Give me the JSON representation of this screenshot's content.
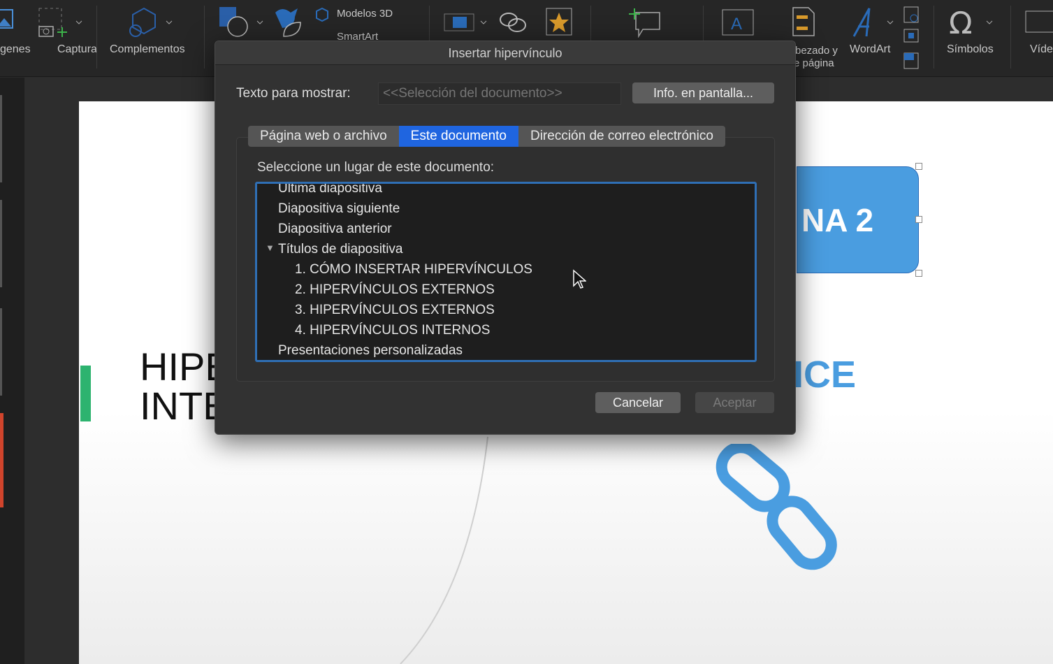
{
  "ribbon": {
    "items": [
      "genes",
      "Captura",
      "Complementos",
      "Modelos 3D",
      "SmartArt",
      "bezado y",
      "e página",
      "WordArt",
      "Símbolos",
      "Víde"
    ]
  },
  "dialog": {
    "title": "Insertar hipervínculo",
    "display_text_label": "Texto para mostrar:",
    "display_text_placeholder": "<<Selección del documento>>",
    "screentip_button": "Info. en pantalla...",
    "tabs": [
      "Página web o archivo",
      "Este documento",
      "Dirección de correo electrónico"
    ],
    "active_tab": "Este documento",
    "select_label": "Seleccione un lugar de este documento:",
    "tree": [
      {
        "label": "Última diapositiva"
      },
      {
        "label": "Diapositiva siguiente"
      },
      {
        "label": "Diapositiva anterior"
      },
      {
        "label": "Títulos de diapositiva",
        "expanded": true
      },
      {
        "label": "1. CÓMO INSERTAR HIPERVÍNCULOS"
      },
      {
        "label": "2. HIPERVÍNCULOS EXTERNOS"
      },
      {
        "label": "3. HIPERVÍNCULOS EXTERNOS"
      },
      {
        "label": "4. HIPERVÍNCULOS INTERNOS"
      },
      {
        "label": "Presentaciones personalizadas"
      }
    ],
    "cancel": "Cancelar",
    "ok": "Aceptar"
  },
  "slide": {
    "title_line1": "HIPE",
    "title_line2": "INTE",
    "button_text": "NA 2",
    "index_text": "ICE"
  },
  "colors": {
    "accent": "#1f65e0",
    "slide_blue": "#4a9de0",
    "green": "#2db36f"
  }
}
